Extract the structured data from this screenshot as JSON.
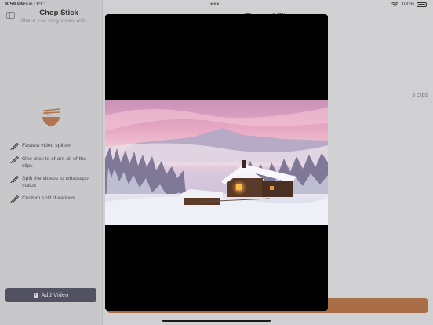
{
  "status_bar": {
    "time": "8:59 PM",
    "date": "Sun Oct 1",
    "multitask_dots": "•••",
    "battery": "100%"
  },
  "sidebar": {
    "app_title": "Chop Stick",
    "subtitle": "Share you long video with...",
    "features": [
      {
        "label": "Fastest video splitter"
      },
      {
        "label": "One click to share all of the clips"
      },
      {
        "label": "Split the videos to whatsapp status"
      },
      {
        "label": "Custom split durations"
      }
    ],
    "add_video_label": "Add Video"
  },
  "main": {
    "title": "Chopped Clips",
    "clip_count": "3 clips"
  },
  "colors": {
    "accent": "#b86e3c",
    "button_dark": "#4a4a5e",
    "logo": "#c27848"
  },
  "icons": {
    "sidebar_toggle": "sidebar-toggle-icon",
    "feature_bullet": "chopsticks-icon",
    "logo": "noodle-bowl-icon",
    "add": "plus-square-icon",
    "wifi": "wifi-icon",
    "battery": "battery-icon"
  }
}
